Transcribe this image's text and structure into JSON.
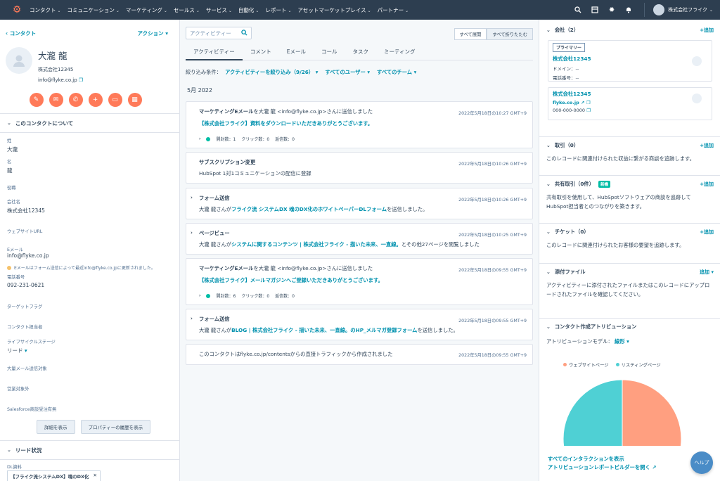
{
  "nav": {
    "items": [
      "コンタクト",
      "コミュニケーション",
      "マーケティング",
      "セールス",
      "サービス",
      "自動化",
      "レポート",
      "アセットマーケットプレイス",
      "パートナー"
    ],
    "account_name": "株式会社フライク"
  },
  "left": {
    "back_label": "コンタクト",
    "actions_label": "アクション",
    "contact_name": "大瀧 龍",
    "company": "株式会社12345",
    "email": "info@flyke.co.jp",
    "about_title": "このコンタクトについて",
    "props": {
      "last_name_label": "姓",
      "last_name": "大瀧",
      "first_name_label": "名",
      "first_name": "龍",
      "title_label": "役職",
      "company_label": "会社名",
      "company": "株式会社12345",
      "website_label": "ウェブサイトURL",
      "email_label": "Eメール",
      "email": "info@flyke.co.jp",
      "email_note": "Eメールはフォーム送信によって最近info@flyke.co.jpに更新されました。",
      "phone_label": "電話番号",
      "phone": "092-231-0621",
      "target_label": "ターゲットフラグ",
      "owner_label": "コンタクト担当者",
      "lifecycle_label": "ライフサイクルステージ",
      "lifecycle": "リード",
      "mail_target_label": "大量メール送信対象",
      "sales_exclude_label": "営業対象外",
      "salesforce_label": "Salesforce商談受注有無"
    },
    "show_details": "詳細を表示",
    "property_history": "プロパティーの履歴を表示",
    "lead_title": "リード状況",
    "dl_label": "DL資料",
    "dl_tag": "【フライク流システムDX】魂のDX化"
  },
  "middle": {
    "search_placeholder": "アクティビティー",
    "expand_all": "すべて展開",
    "collapse_all": "すべて折りたたむ",
    "tabs": [
      "アクティビティー",
      "コメント",
      "Eメール",
      "コール",
      "タスク",
      "ミーティング"
    ],
    "filter_label": "絞り込み条件：",
    "filter_activity": "アクティビティーを絞り込み（9/26）",
    "filter_users": "すべてのユーザー",
    "filter_teams": "すべてのチーム",
    "month": "5月 2022",
    "cards": [
      {
        "title_bold": "マーケティングEメール",
        "title_rest": "を大瀧 龍 <info@flyke.co.jp>さんに送信しました",
        "time": "2022年5月18日の10:27 GMT+9",
        "link": "【株式会社フライク】資料をダウンロードいただきありがとうございます。",
        "stats": [
          "開封数：1",
          "クリック数：0",
          "返信数：0"
        ]
      },
      {
        "title": "サブスクリプション変更",
        "time": "2022年5月18日の10:26 GMT+9",
        "text": "HubSpot 1対1コミュニケーションの配信に登録"
      },
      {
        "title": "フォーム送信",
        "time": "2022年5月18日の10:26 GMT+9",
        "pre": "大瀧 龍さんが",
        "link": "フライク流 システムDX 魂のDX化のホワイトペーパーDLフォーム",
        "post": "を送信しました。"
      },
      {
        "title": "ページビュー",
        "time": "2022年5月18日の10:25 GMT+9",
        "pre": "大瀧 龍さんが",
        "link": "システムに関するコンテンツ | 株式会社フライク - 描いた未来、一直線。",
        "post": "とその他27ページを閲覧しました"
      },
      {
        "title_bold": "マーケティングEメール",
        "title_rest": "を大瀧 龍 <info@flyke.co.jp>さんに送信しました",
        "time": "2022年5月18日の09:55 GMT+9",
        "link": "【株式会社フライク】メールマガジンへご登録いただきありがとうございます。",
        "stats": [
          "開封数：6",
          "クリック数：0",
          "返信数：0"
        ]
      },
      {
        "title": "フォーム送信",
        "time": "2022年5月18日の09:55 GMT+9",
        "pre": "大瀧 龍さんが",
        "link": "BLOG | 株式会社フライク - 描いた未来、一直線。のHP_メルマガ登録フォーム",
        "post": "を送信しました。"
      },
      {
        "text": "このコンタクトはflyke.co.jp/contentsからの直接トラフィックから作成されました",
        "time": "2022年5月18日の09:55 GMT+9"
      }
    ]
  },
  "right": {
    "companies_title": "会社（2）",
    "add": "+追加",
    "primary_badge": "プライマリー",
    "company1": {
      "name": "株式会社12345",
      "domain": "ドメイン：--",
      "phone": "電話番号：--"
    },
    "company2": {
      "name": "株式会社12345",
      "domain": "flyke.co.jp",
      "phone": "000-000-0000"
    },
    "deals_title": "取引（0）",
    "deals_text": "このレコードに関連付けられた収益に繋がる商談を追跡します。",
    "shared_title": "共有取引（0件）",
    "new_badge": "新機",
    "shared_text": "共有取引を使用して、HubSpotソフトウェアの商談を追跡して HubSpot担当者とのつながりを築きます。",
    "tickets_title": "チケット（0）",
    "tickets_text": "このレコードに関連付けられたお客様の要望を追跡します。",
    "attach_title": "添付ファイル",
    "attach_add": "追加",
    "attach_text": "アクティビティーに添付されたファイルまたはこのレコードにアップロードされたファイルを確認してください。",
    "attrib_title": "コンタクト作成アトリビューション",
    "model_label": "アトリビューションモデル：",
    "model_value": "線形",
    "link1": "すべてのインタラクションを表示",
    "link2": "アトリビューションレポートビルダーを開く"
  },
  "chart_data": {
    "type": "pie",
    "categories": [
      "ウェブサイトページ",
      "リスティングページ"
    ],
    "values": [
      50,
      50
    ],
    "colors": [
      "#ff9f80",
      "#4fd0d4"
    ],
    "legend": "top"
  },
  "help_label": "ヘルプ",
  "colors": {
    "accent": "#ff7a59",
    "link": "#0091ae",
    "nav": "#2d3e50"
  }
}
